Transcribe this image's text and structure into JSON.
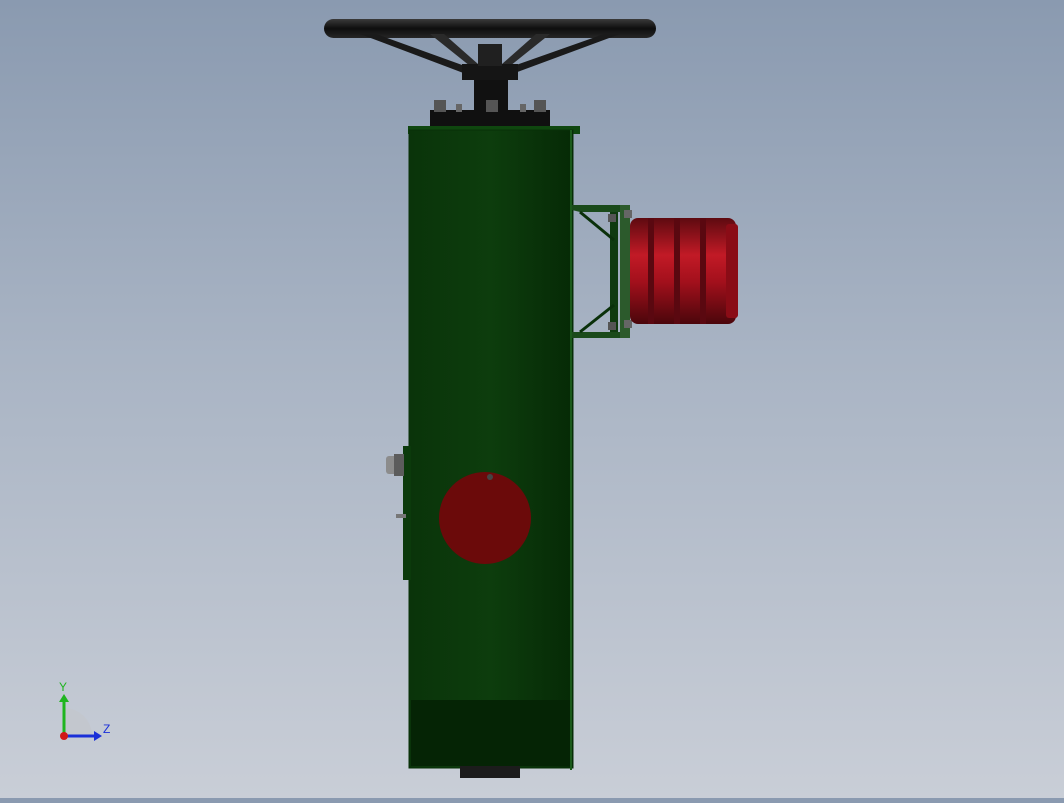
{
  "viewport": {
    "background_top": "#8a9ab0",
    "background_bottom": "#c9ced7"
  },
  "model": {
    "body_color": "#0c3a0c",
    "body_dark": "#062806",
    "handwheel_color": "#1b1b1b",
    "motor_color": "#a3101c",
    "indicator_color": "#6b0a0a"
  },
  "triad": {
    "y_label": "Y",
    "z_label": "Z",
    "y_color": "#1fb51f",
    "z_color": "#1a2fd8",
    "x_color": "#d01818"
  }
}
